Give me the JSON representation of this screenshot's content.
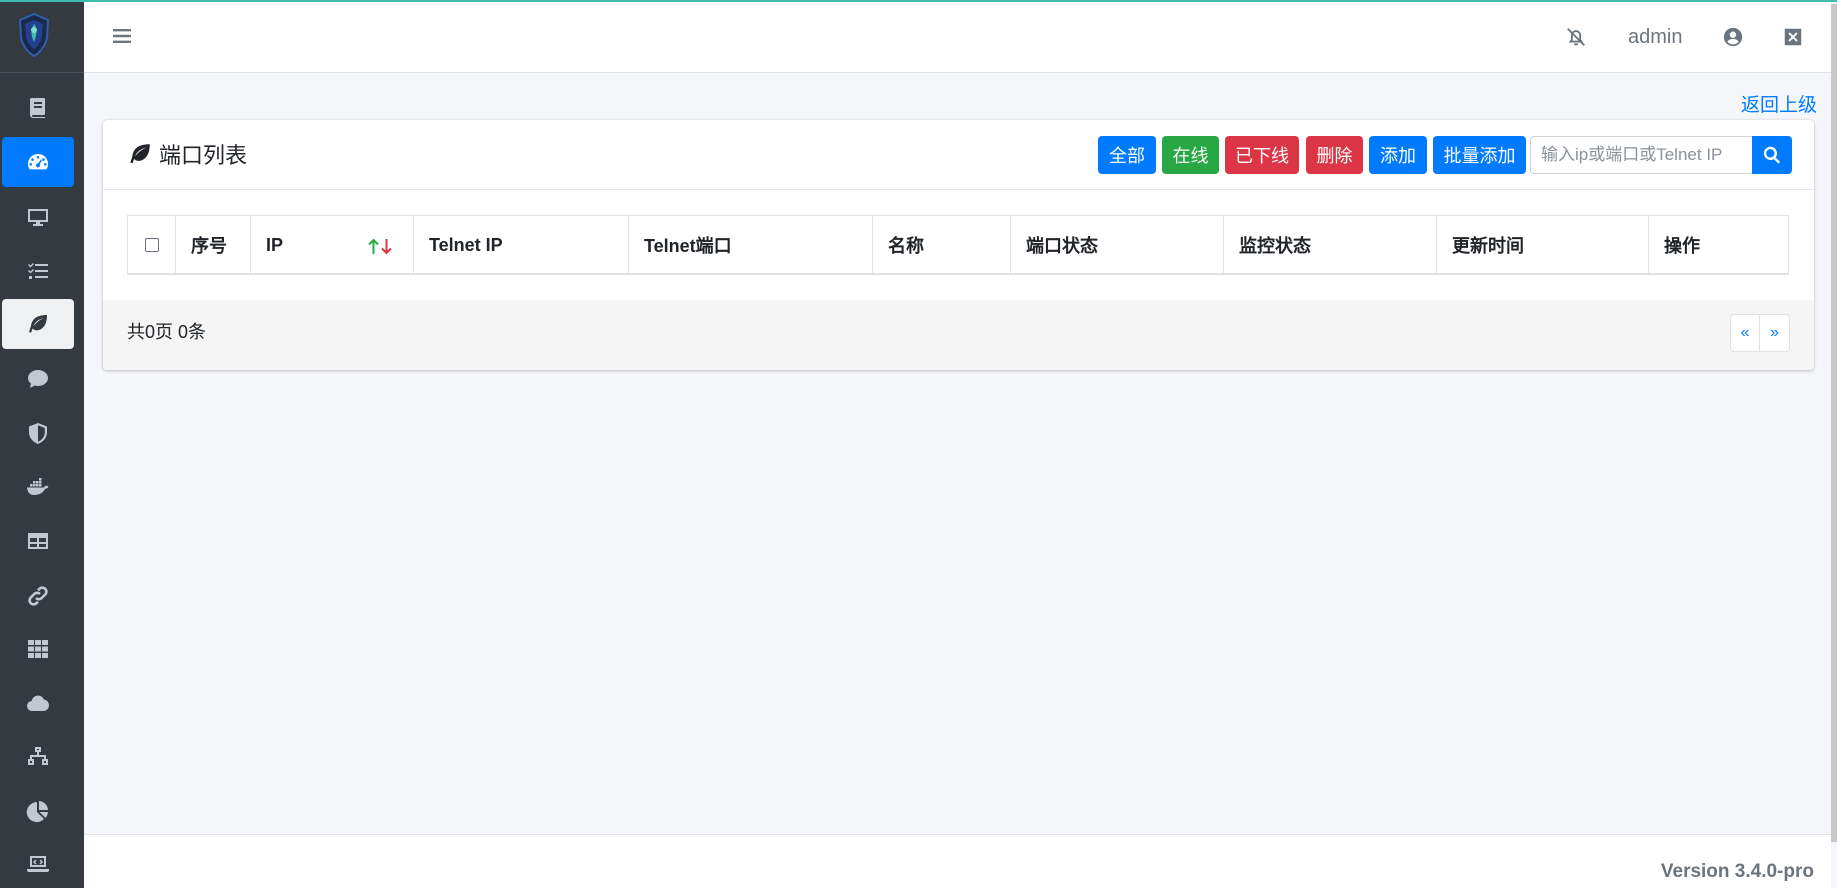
{
  "sidebar": {
    "items": [
      {
        "name": "book-icon"
      },
      {
        "name": "dashboard-icon"
      },
      {
        "name": "desktop-icon"
      },
      {
        "name": "tasks-icon"
      },
      {
        "name": "leaf-icon"
      },
      {
        "name": "comment-icon"
      },
      {
        "name": "shield-icon"
      },
      {
        "name": "docker-icon"
      },
      {
        "name": "table-icon"
      },
      {
        "name": "link-icon"
      },
      {
        "name": "grid-icon"
      },
      {
        "name": "cloud-icon"
      },
      {
        "name": "network-icon"
      },
      {
        "name": "pie-chart-icon"
      },
      {
        "name": "laptop-code-icon"
      }
    ]
  },
  "header": {
    "user": "admin"
  },
  "back_link": "返回上级",
  "card": {
    "title": "端口列表",
    "buttons": {
      "all": "全部",
      "online": "在线",
      "offline": "已下线",
      "delete": "删除",
      "add": "添加",
      "batch_add": "批量添加"
    },
    "search_placeholder": "输入ip或端口或Telnet IP"
  },
  "table": {
    "columns": [
      "序号",
      "IP",
      "Telnet IP",
      "Telnet端口",
      "名称",
      "端口状态",
      "监控状态",
      "更新时间",
      "操作"
    ],
    "rows": []
  },
  "pagination": {
    "info": "共0页 0条",
    "prev": "«",
    "next": "»"
  },
  "footer": {
    "version": "Version 3.4.0-pro"
  },
  "colors": {
    "sidebar_bg": "#343a40",
    "primary": "#007bff",
    "success": "#28a745",
    "danger": "#dc3545",
    "accent_line": "#3fbcae"
  }
}
